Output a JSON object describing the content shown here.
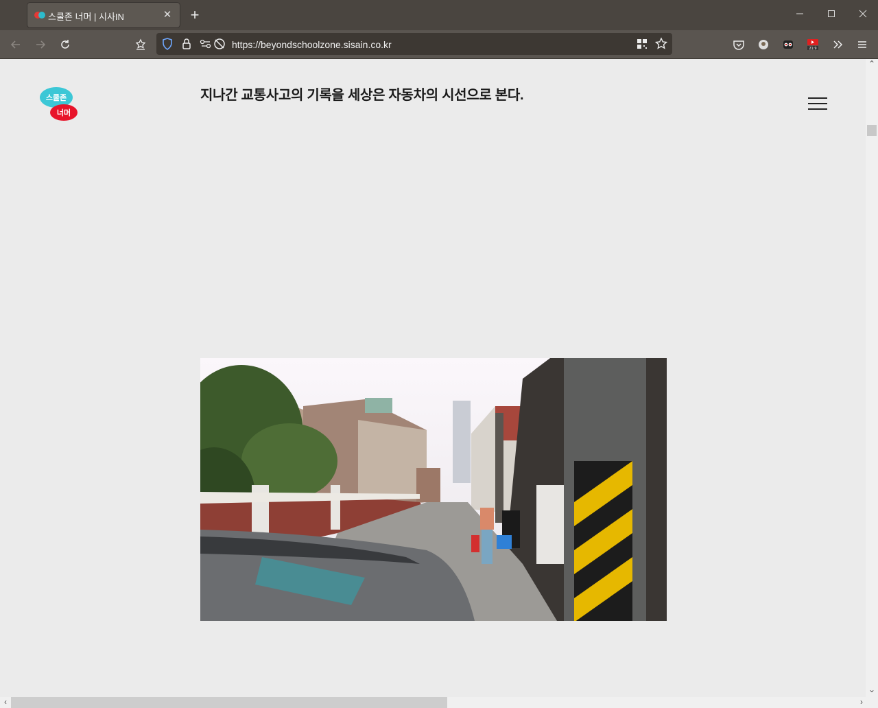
{
  "browser": {
    "tab": {
      "title": "스쿨존 너머 | 시사IN",
      "close_label": "✕"
    },
    "new_tab_label": "+",
    "url": "https://beyondschoolzone.sisain.co.kr",
    "extension_badge": "21:9"
  },
  "page": {
    "logo": {
      "line1": "스쿨존",
      "line2": "너머"
    },
    "headline": "지나간 교통사고의 기록을 세상은 자동차의 시선으로 본다."
  },
  "icons": {
    "back": "arrow-left-icon",
    "forward": "arrow-right-icon",
    "reload": "reload-icon",
    "menu": "hamburger-menu-icon"
  }
}
